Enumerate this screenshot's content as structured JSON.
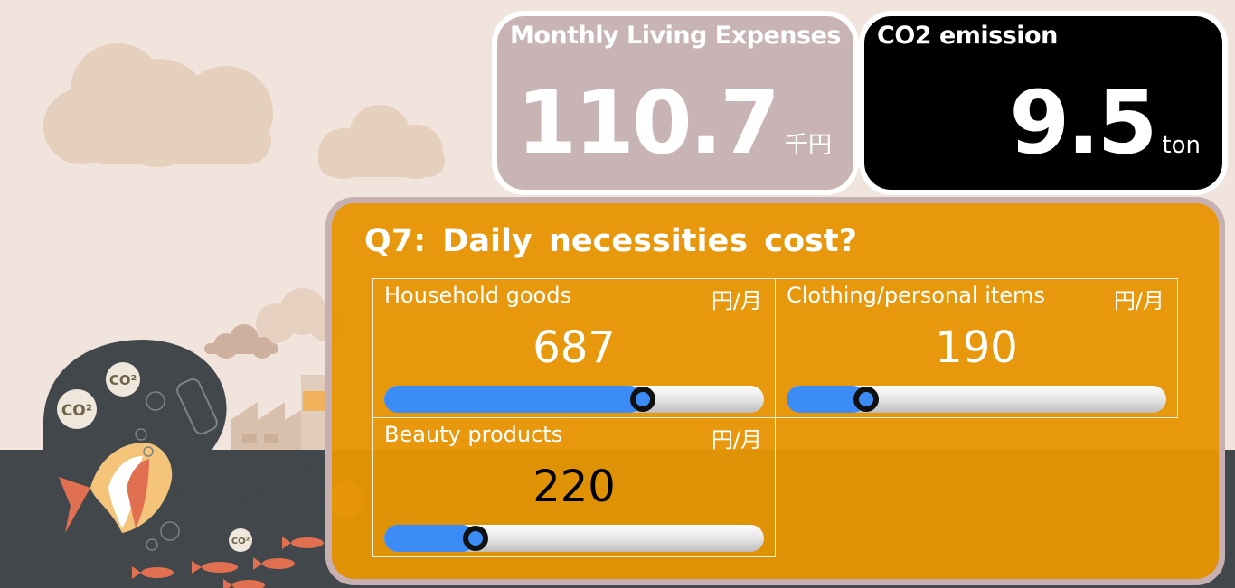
{
  "expenses": {
    "title": "Monthly Living Expenses",
    "value": "110.7",
    "unit": "千円",
    "color": "#c9b4b5"
  },
  "co2": {
    "title": "CO2 emission",
    "value": "9.5",
    "unit": "ton",
    "color": "#000000"
  },
  "question": {
    "title": "Q7:  Daily necessities cost?",
    "panel_color": "#e79504",
    "items": [
      {
        "label": "Household goods",
        "unit": "円/月",
        "value": "687",
        "value_color": "#ffffff",
        "fill": 0.68
      },
      {
        "label": "Clothing/personal items",
        "unit": "円/月",
        "value": "190",
        "value_color": "#ffffff",
        "fill": 0.21
      },
      {
        "label": "Beauty products",
        "unit": "円/月",
        "value": "220",
        "value_color": "#000000",
        "fill": 0.24
      }
    ]
  },
  "background": {
    "bubbles": [
      "CO2",
      "CO2",
      "CO2",
      "CO2"
    ]
  },
  "colors": {
    "slider_fill": "#3b8cf5",
    "background": "#f1e4dc"
  }
}
